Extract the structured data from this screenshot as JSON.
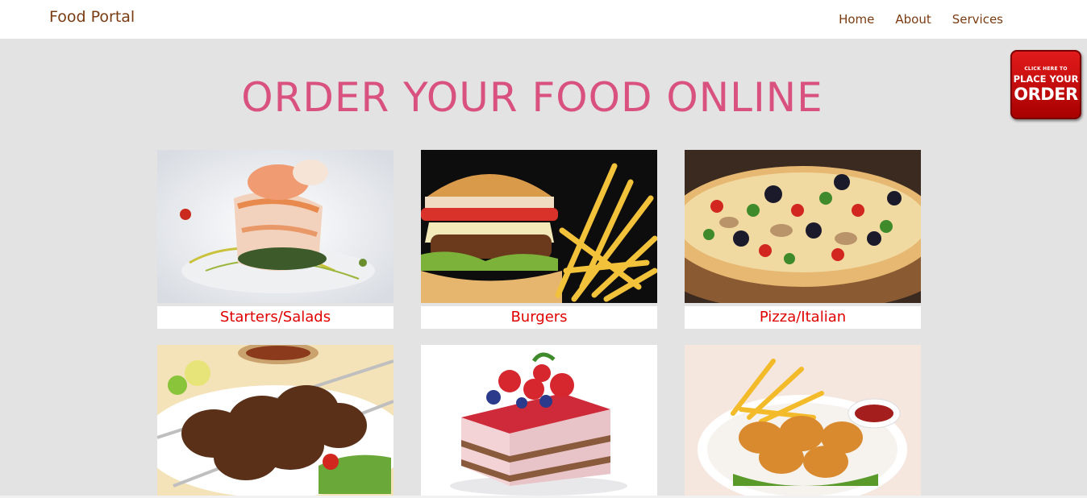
{
  "navbar": {
    "brand": "Food Portal",
    "links": [
      "Home",
      "About",
      "Services"
    ]
  },
  "order_badge": {
    "line1": "CLICK HERE TO",
    "line2": "PLACE YOUR",
    "line3": "ORDER"
  },
  "hero": {
    "title": "ORDER YOUR FOOD ONLINE"
  },
  "categories": [
    {
      "label": "Starters/Salads",
      "image": "starter-salad-photo"
    },
    {
      "label": "Burgers",
      "image": "burger-fries-photo"
    },
    {
      "label": "Pizza/Italian",
      "image": "pizza-photo"
    },
    {
      "label": "",
      "image": "kebab-photo"
    },
    {
      "label": "",
      "image": "cake-dessert-photo"
    },
    {
      "label": "",
      "image": "chicken-nuggets-photo"
    }
  ],
  "colors": {
    "brand": "#7a3b12",
    "title": "#d9527f",
    "label": "#e00000",
    "badge": "#d10000"
  }
}
